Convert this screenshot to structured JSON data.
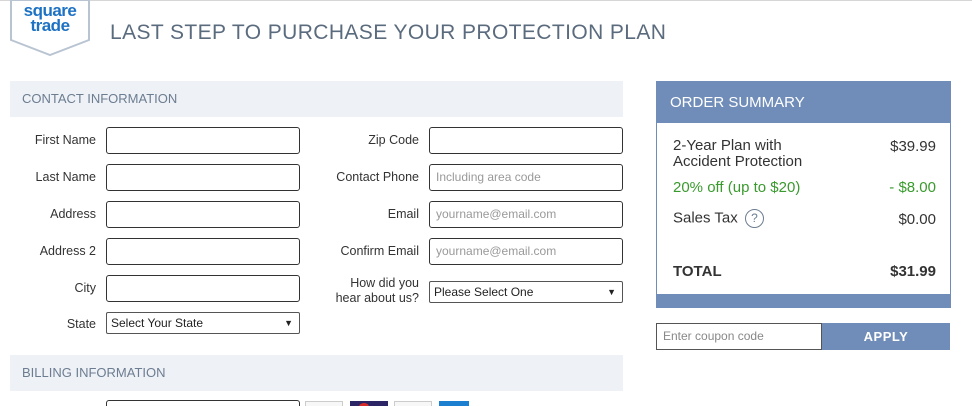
{
  "brand": {
    "logo_line1": "square",
    "logo_line2": "trade",
    "logo_color": "#1d72c4"
  },
  "page": {
    "title": "LAST STEP TO PURCHASE YOUR PROTECTION PLAN"
  },
  "contact": {
    "header": "CONTACT INFORMATION",
    "first_name": {
      "label": "First Name",
      "value": ""
    },
    "last_name": {
      "label": "Last Name",
      "value": ""
    },
    "address": {
      "label": "Address",
      "value": ""
    },
    "address2": {
      "label": "Address 2",
      "value": ""
    },
    "city": {
      "label": "City",
      "value": ""
    },
    "state": {
      "label": "State",
      "selected": "Select Your State"
    },
    "zip": {
      "label": "Zip Code",
      "value": ""
    },
    "phone": {
      "label": "Contact Phone",
      "placeholder": "Including area code"
    },
    "email": {
      "label": "Email",
      "placeholder": "yourname@email.com"
    },
    "confirm_email": {
      "label": "Confirm Email",
      "placeholder": "yourname@email.com"
    },
    "referral": {
      "label_line1": "How did you",
      "label_line2": "hear about us?",
      "selected": "Please Select One"
    }
  },
  "billing": {
    "header": "BILLING INFORMATION",
    "card_icons": [
      "generic-card-icon",
      "mastercard-icon",
      "generic-card-icon",
      "amex-icon"
    ]
  },
  "summary": {
    "header": "ORDER SUMMARY",
    "plan_line1": "2-Year Plan with",
    "plan_line2": "Accident Protection",
    "plan_price": "$39.99",
    "discount_label": "20% off (up to $20)",
    "discount_value": "- $8.00",
    "tax_label": "Sales Tax",
    "tax_help": "?",
    "tax_value": "$0.00",
    "total_label": "TOTAL",
    "total_value": "$31.99",
    "accent_color": "#6f8db8",
    "discount_color": "#3a9a2e"
  },
  "coupon": {
    "placeholder": "Enter coupon code",
    "apply_label": "APPLY"
  }
}
